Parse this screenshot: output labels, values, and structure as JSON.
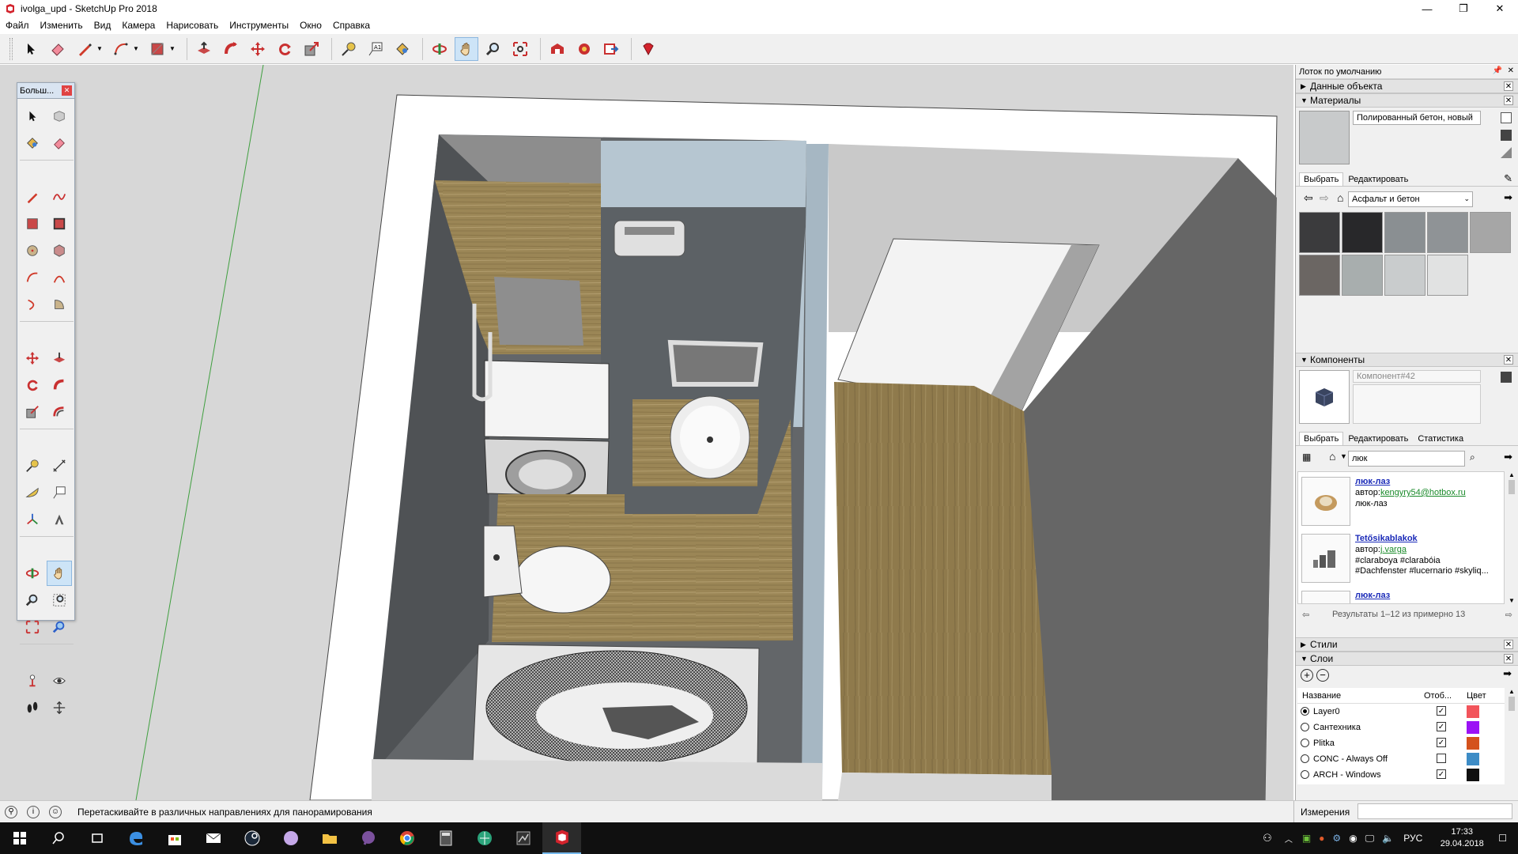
{
  "window": {
    "title": "ivolga_upd - SketchUp Pro 2018",
    "minimize": "—",
    "maximize": "❐",
    "close": "✕"
  },
  "menu": [
    "Файл",
    "Изменить",
    "Вид",
    "Камера",
    "Нарисовать",
    "Инструменты",
    "Окно",
    "Справка"
  ],
  "toolset": {
    "title": "Больш...",
    "close": "✕"
  },
  "tray": {
    "title": "Лоток по умолчанию",
    "entity_info": {
      "title": "Данные объекта"
    },
    "materials": {
      "title": "Материалы",
      "name_value": "Полированный бетон, новый",
      "tabs": [
        "Выбрать",
        "Редактировать"
      ],
      "library": "Асфальт и бетон",
      "swatches": [
        "#3b3b3d",
        "#28282a",
        "#8a8f92",
        "#8f9396",
        "#a6a6a6",
        "#6b6663",
        "#a8aeae",
        "#c9cccd",
        "#e1e2e2"
      ]
    },
    "components": {
      "title": "Компоненты",
      "name_placeholder": "Компонент#42",
      "tabs": [
        "Выбрать",
        "Редактировать",
        "Статистика"
      ],
      "search_value": "люк",
      "results": [
        {
          "title": "люк-лаз",
          "author_prefix": "автор:",
          "author": "kengyry54@hotbox.ru",
          "desc": "люк-лаз"
        },
        {
          "title": "Tetősikablakok",
          "author_prefix": "автор:",
          "author": "j.varga",
          "desc": "#claraboya #clarabóia",
          "desc2": "#Dachfenster #lucernario #skyliq..."
        },
        {
          "title": "люк-лаз",
          "author_prefix": "",
          "author": "",
          "desc": ""
        }
      ],
      "results_text": "Результаты 1–12 из примерно 13"
    },
    "styles": {
      "title": "Стили"
    },
    "layers": {
      "title": "Слои",
      "col_name": "Название",
      "col_visible": "Отоб...",
      "col_color": "Цвет",
      "rows": [
        {
          "name": "Layer0",
          "active": true,
          "visible": true,
          "color": "#f2545b"
        },
        {
          "name": "Сантехника",
          "active": false,
          "visible": true,
          "color": "#9b13f5"
        },
        {
          "name": "Plitka",
          "active": false,
          "visible": true,
          "color": "#d4521d"
        },
        {
          "name": "CONC - Always Off",
          "active": false,
          "visible": false,
          "color": "#3d8cc6"
        },
        {
          "name": "ARCH - Windows",
          "active": false,
          "visible": true,
          "color": "#101010"
        }
      ]
    }
  },
  "status": {
    "hint": "Перетаскивайте в различных направлениях для панорамирования",
    "measurements_label": "Измерения"
  },
  "taskbar": {
    "language": "РУС",
    "time": "17:33",
    "date": "29.04.2018"
  }
}
